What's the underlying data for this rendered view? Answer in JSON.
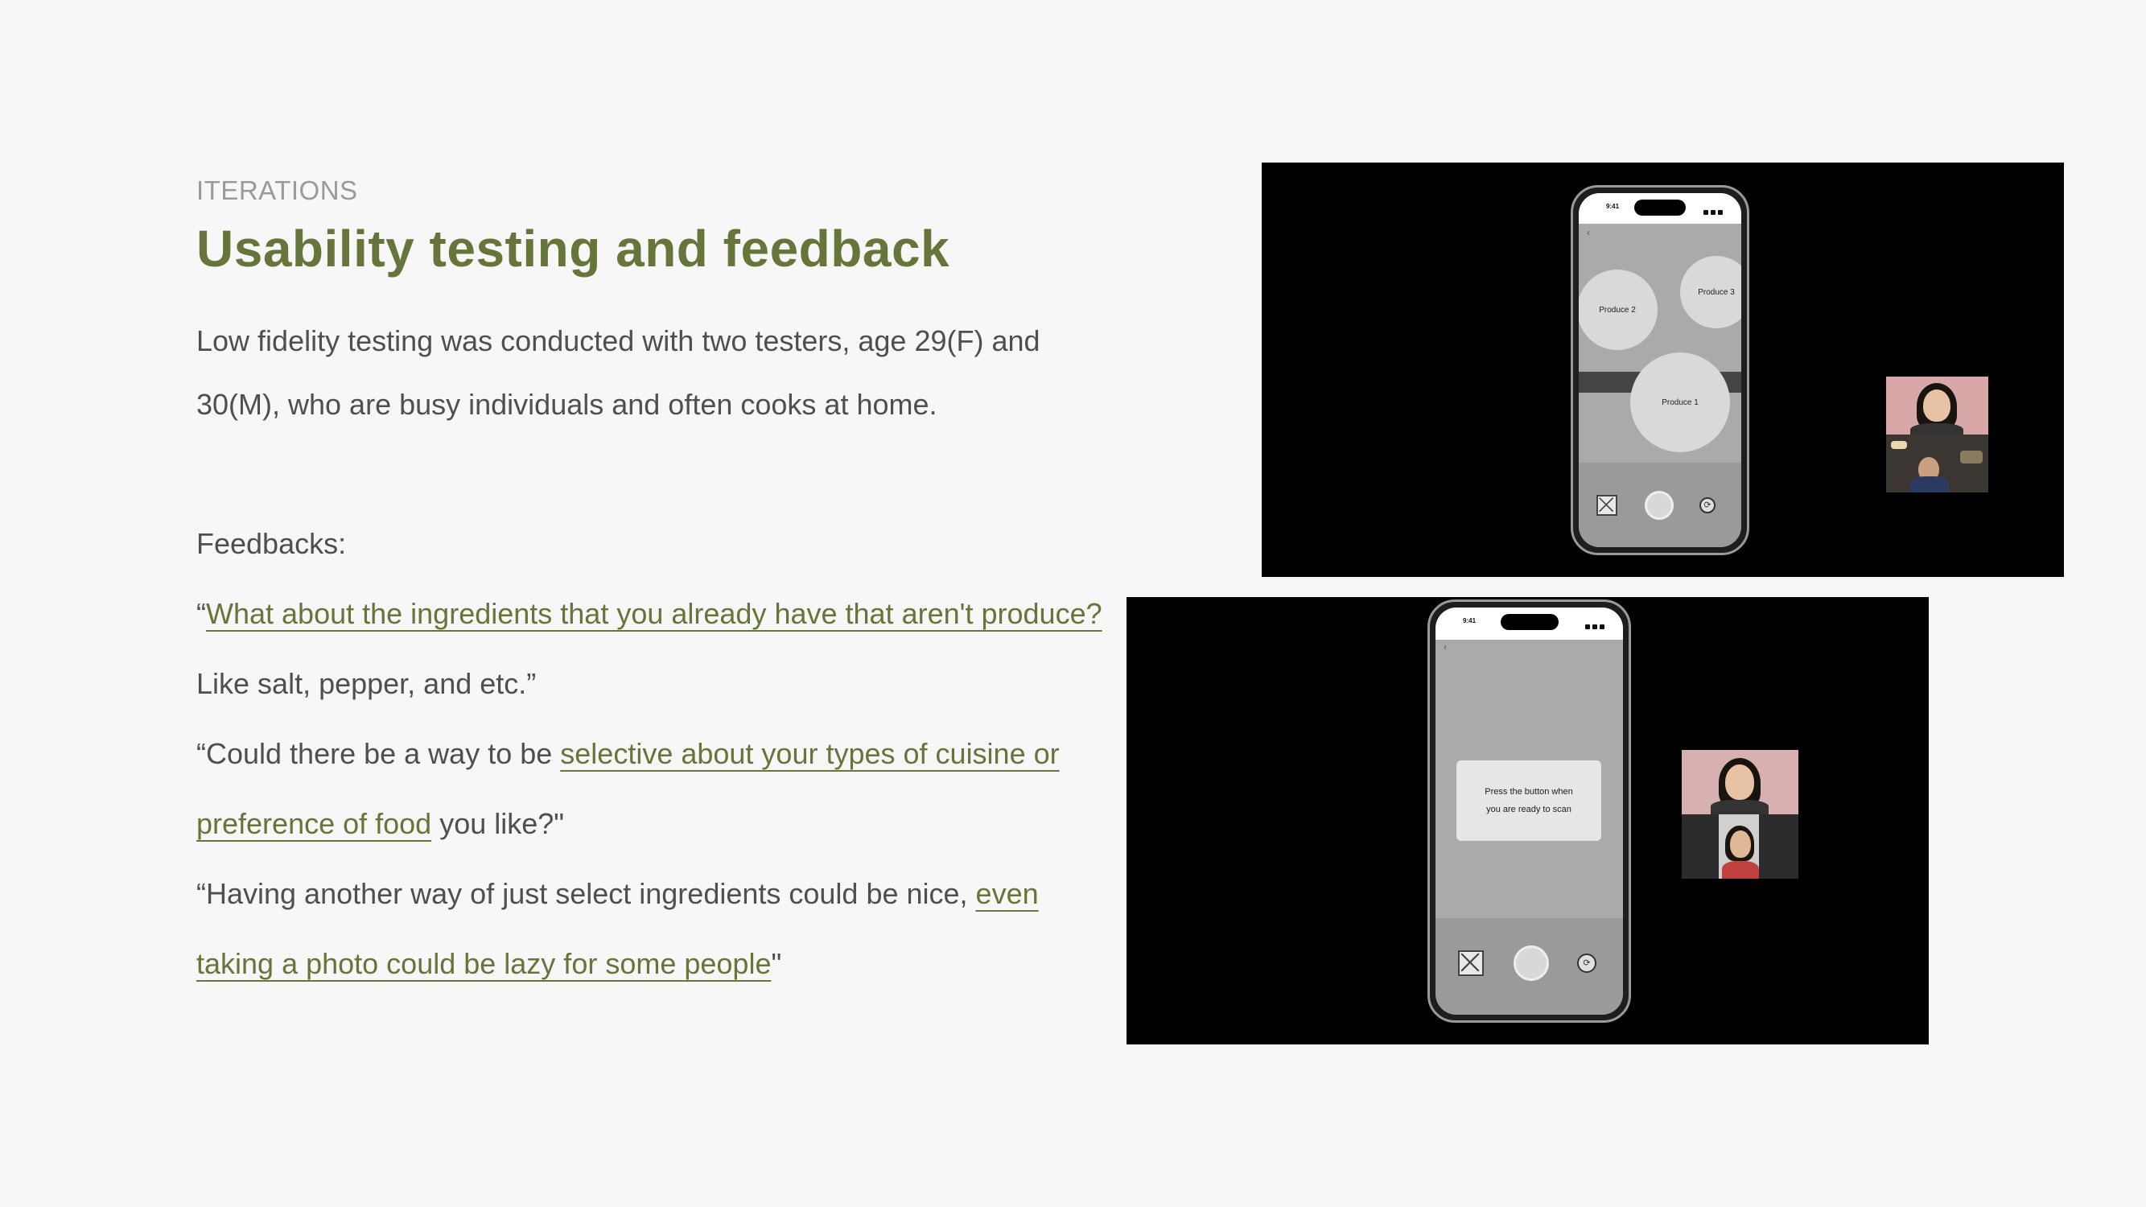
{
  "eyebrow": "ITERATIONS",
  "title": "Usability testing and feedback",
  "intro": "Low fidelity testing was conducted with two testers, age 29(F) and 30(M), who are busy individuals and often cooks at home.",
  "feedbacks": {
    "heading": "Feedbacks:",
    "q1": {
      "open": "“",
      "link": "What about the ingredients that you already have that aren't produce?",
      "rest": " Like salt, pepper, and etc.”"
    },
    "q2": {
      "open": "“Could there be a way to be ",
      "link": "selective about your types of cuisine or preference of food",
      "rest": " you like?\""
    },
    "q3": {
      "open": "“Having another way of just select ingredients could be nice, ",
      "link": "even taking a photo could be lazy for some people",
      "rest": "\""
    }
  },
  "screens": {
    "top": {
      "time": "9:41",
      "produce_1": "Produce 1",
      "produce_2": "Produce 2",
      "produce_3": "Produce 3"
    },
    "bottom": {
      "time": "9:41",
      "prompt_line1": "Press the button when",
      "prompt_line2": "you are ready to scan"
    }
  },
  "colors": {
    "accent": "#66753a",
    "background": "#f7f7f7",
    "body_text": "#4f4f4f",
    "eyebrow": "#9a9a9a"
  }
}
